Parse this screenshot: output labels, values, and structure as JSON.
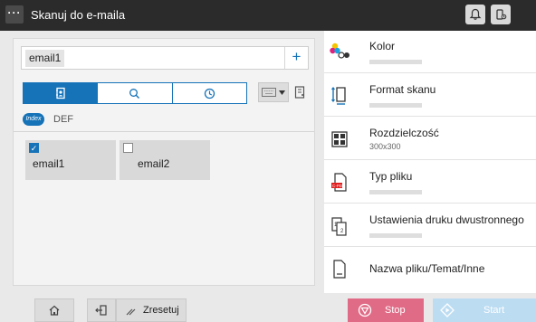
{
  "header": {
    "menu_label": "···",
    "title": "Skanuj do e-maila",
    "bell_icon": "bell-icon",
    "device_icon": "phone-device-icon"
  },
  "address": {
    "value": "email1",
    "add_label": "+"
  },
  "search_tabs": [
    {
      "icon": "address-book-icon",
      "active": true
    },
    {
      "icon": "search-icon",
      "active": false
    },
    {
      "icon": "clock-history-icon",
      "active": false
    }
  ],
  "index": {
    "badge": "Index",
    "label": "DEF"
  },
  "destinations": [
    {
      "name": "email1",
      "checked": true
    },
    {
      "name": "email2",
      "checked": false
    }
  ],
  "settings": [
    {
      "label": "Kolor",
      "value": ""
    },
    {
      "label": "Format skanu",
      "value": ""
    },
    {
      "label": "Rozdzielczość",
      "value": "300x300"
    },
    {
      "label": "Typ pliku",
      "value": ""
    },
    {
      "label": "Ustawienia druku dwustronnego",
      "value": ""
    },
    {
      "label": "Nazwa pliku/Temat/Inne",
      "value": ""
    }
  ],
  "bottom": {
    "reset_label": "Zresetuj",
    "stop_label": "Stop",
    "start_label": "Start"
  },
  "colors": {
    "accent": "#1673b8",
    "stop": "#e06b86",
    "start": "#bcdcf2",
    "topbar": "#2b2b2b"
  }
}
